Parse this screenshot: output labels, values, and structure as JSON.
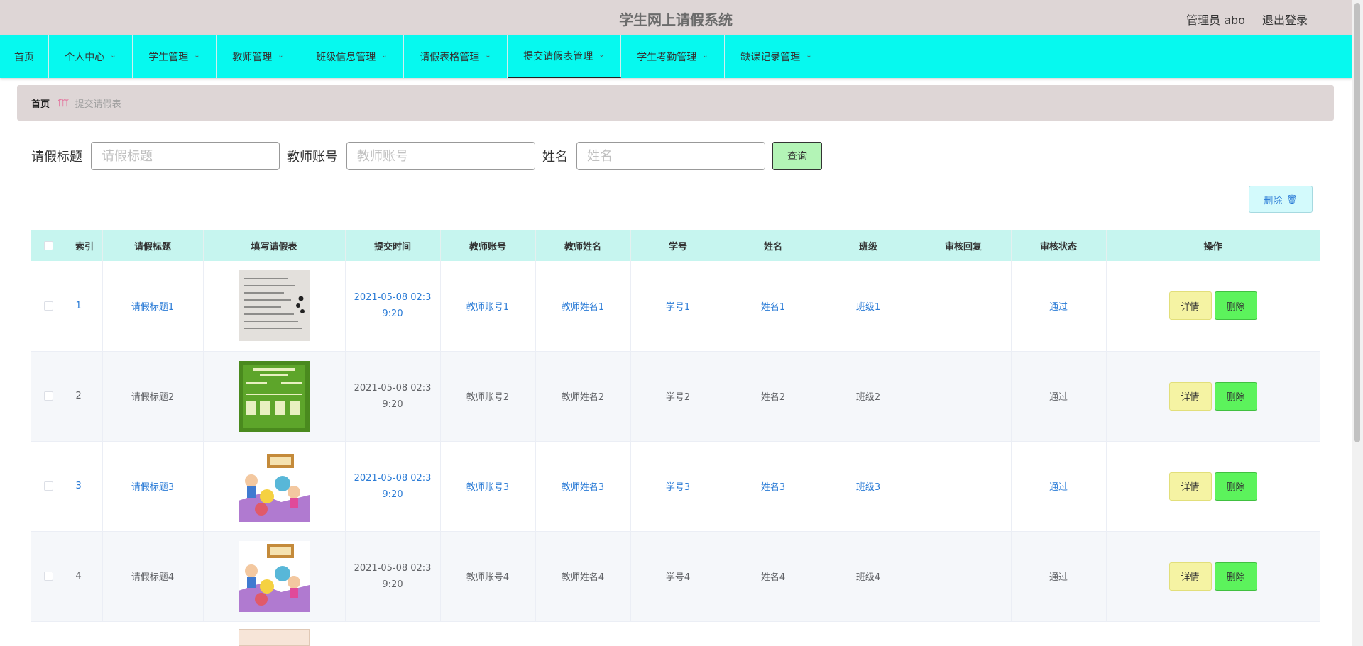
{
  "header": {
    "title": "学生网上请假系统",
    "user": "管理员 abo",
    "logout": "退出登录"
  },
  "nav": {
    "items": [
      {
        "label": "首页",
        "dropdown": false
      },
      {
        "label": "个人中心",
        "dropdown": true
      },
      {
        "label": "学生管理",
        "dropdown": true
      },
      {
        "label": "教师管理",
        "dropdown": true
      },
      {
        "label": "班级信息管理",
        "dropdown": true
      },
      {
        "label": "请假表格管理",
        "dropdown": true
      },
      {
        "label": "提交请假表管理",
        "dropdown": true,
        "active": true
      },
      {
        "label": "学生考勤管理",
        "dropdown": true
      },
      {
        "label": "缺课记录管理",
        "dropdown": true
      }
    ]
  },
  "breadcrumb": {
    "home": "首页",
    "current": "提交请假表"
  },
  "search": {
    "title_label": "请假标题",
    "title_placeholder": "请假标题",
    "account_label": "教师账号",
    "account_placeholder": "教师账号",
    "name_label": "姓名",
    "name_placeholder": "姓名",
    "query_button": "查询"
  },
  "toolbar": {
    "delete_label": "删除"
  },
  "table": {
    "columns": [
      "索引",
      "请假标题",
      "填写请假表",
      "提交时间",
      "教师账号",
      "教师姓名",
      "学号",
      "姓名",
      "班级",
      "审核回复",
      "审核状态",
      "操作"
    ],
    "rows": [
      {
        "index": "1",
        "title": "请假标题1",
        "image": "handwritten-notes",
        "time": "2021-05-08 02:39:20",
        "teacher_account": "教师账号1",
        "teacher_name": "教师姓名1",
        "student_id": "学号1",
        "name": "姓名1",
        "class": "班级1",
        "reply": "",
        "status": "通过"
      },
      {
        "index": "2",
        "title": "请假标题2",
        "image": "green-chalkboard",
        "time": "2021-05-08 02:39:20",
        "teacher_account": "教师账号2",
        "teacher_name": "教师姓名2",
        "student_id": "学号2",
        "name": "姓名2",
        "class": "班级2",
        "reply": "",
        "status": "通过"
      },
      {
        "index": "3",
        "title": "请假标题3",
        "image": "english-cartoon",
        "time": "2021-05-08 02:39:20",
        "teacher_account": "教师账号3",
        "teacher_name": "教师姓名3",
        "student_id": "学号3",
        "name": "姓名3",
        "class": "班级3",
        "reply": "",
        "status": "通过"
      },
      {
        "index": "4",
        "title": "请假标题4",
        "image": "english-cartoon",
        "time": "2021-05-08 02:39:20",
        "teacher_account": "教师账号4",
        "teacher_name": "教师姓名4",
        "student_id": "学号4",
        "name": "姓名4",
        "class": "班级4",
        "reply": "",
        "status": "通过"
      }
    ],
    "detail_button": "详情",
    "delete_button": "删除"
  },
  "colors": {
    "topbar": "#ded6d6",
    "nav": "#06f9ef",
    "table_header": "#c6f5ef",
    "link": "#2a7bd6",
    "detail_button": "#f5f3a3",
    "delete_button": "#5cf35c",
    "query_button": "#b3f4b6"
  }
}
